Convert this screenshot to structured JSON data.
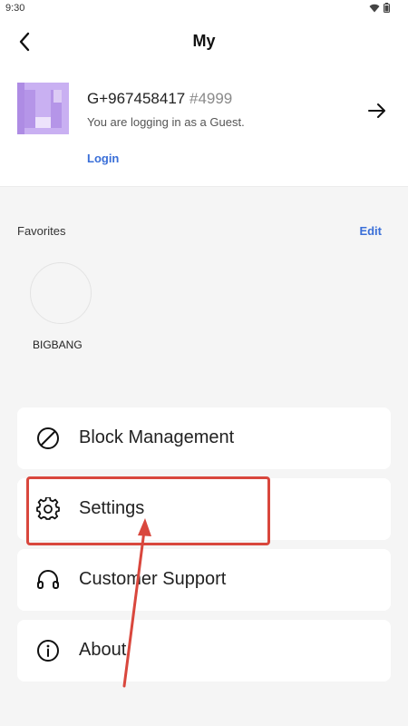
{
  "status_bar": {
    "time": "9:30"
  },
  "header": {
    "title": "My"
  },
  "profile": {
    "guest_id": "G+967458417",
    "tag": "#4999",
    "note": "You are logging in as a Guest.",
    "login_label": "Login"
  },
  "favorites": {
    "title": "Favorites",
    "edit_label": "Edit",
    "items": [
      {
        "label": "BIGBANG"
      }
    ]
  },
  "menu": [
    {
      "label": "Block Management",
      "icon": "block-icon"
    },
    {
      "label": "Settings",
      "icon": "gear-icon"
    },
    {
      "label": "Customer Support",
      "icon": "headset-icon"
    },
    {
      "label": "About",
      "icon": "info-icon"
    }
  ],
  "annotation": {
    "color": "#d9473d",
    "highlighted_item": "Settings"
  }
}
